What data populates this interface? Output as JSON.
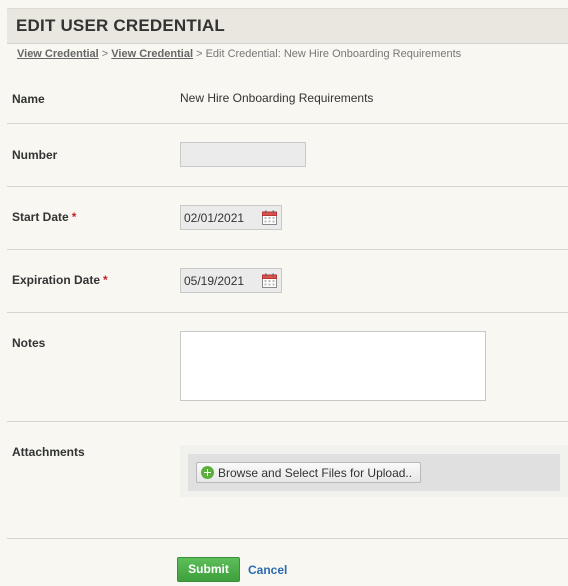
{
  "header": {
    "title": "EDIT USER CREDENTIAL"
  },
  "breadcrumb": {
    "link1": "View Credential",
    "link2": "View Credential",
    "sep": ">",
    "current": "Edit Credential: New Hire Onboarding Requirements"
  },
  "form": {
    "name": {
      "label": "Name",
      "value": "New Hire Onboarding Requirements"
    },
    "number": {
      "label": "Number",
      "value": ""
    },
    "start_date": {
      "label": "Start Date",
      "required": "*",
      "value": "02/01/2021",
      "icon": "calendar-icon"
    },
    "expiration_date": {
      "label": "Expiration Date",
      "required": "*",
      "value": "05/19/2021",
      "icon": "calendar-icon"
    },
    "notes": {
      "label": "Notes",
      "value": ""
    },
    "attachments": {
      "label": "Attachments",
      "button": "Browse and Select Files for Upload..",
      "icon": "plus-circle-icon"
    }
  },
  "actions": {
    "submit": "Submit",
    "cancel": "Cancel"
  },
  "colors": {
    "submit_bg": "#4caf50",
    "link": "#2a6bb0",
    "required": "#c0262d"
  }
}
